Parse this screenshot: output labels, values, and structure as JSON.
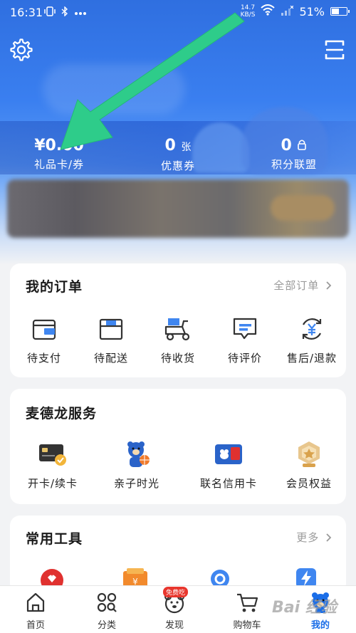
{
  "status_bar": {
    "time": "16:31",
    "speed_value": "14.7",
    "speed_unit": "KB/S",
    "battery": "51%",
    "battery_level": 0.51
  },
  "stats": [
    {
      "value": "¥0.00",
      "unit": "",
      "label": "礼品卡/券"
    },
    {
      "value": "0",
      "unit": "张",
      "label": "优惠券"
    },
    {
      "value": "0",
      "unit": "",
      "label": "积分联盟"
    }
  ],
  "orders": {
    "title": "我的订单",
    "more": "全部订单",
    "items": [
      {
        "label": "待支付",
        "icon": "wallet-icon"
      },
      {
        "label": "待配送",
        "icon": "package-icon"
      },
      {
        "label": "待收货",
        "icon": "delivery-scooter-icon"
      },
      {
        "label": "待评价",
        "icon": "comment-icon"
      },
      {
        "label": "售后/退款",
        "icon": "refund-icon"
      }
    ]
  },
  "services": {
    "title": "麦德龙服务",
    "items": [
      {
        "label": "开卡/续卡",
        "icon": "member-card-icon"
      },
      {
        "label": "亲子时光",
        "icon": "bear-balloon-icon"
      },
      {
        "label": "联名信用卡",
        "icon": "credit-card-icon"
      },
      {
        "label": "会员权益",
        "icon": "medal-icon"
      }
    ]
  },
  "tools": {
    "title": "常用工具",
    "more": "更多"
  },
  "tabbar": {
    "items": [
      {
        "label": "首页",
        "icon": "home-icon"
      },
      {
        "label": "分类",
        "icon": "category-icon"
      },
      {
        "label": "发现",
        "icon": "discover-bear-icon"
      },
      {
        "label": "购物车",
        "icon": "cart-icon"
      },
      {
        "label": "我的",
        "icon": "profile-bear-icon"
      }
    ],
    "discover_badge": "免费吃",
    "active": "我的"
  },
  "watermark": "Bai  经验",
  "colors": {
    "primary": "#1b6ee8",
    "arrow": "#2ecc8a",
    "badge": "#e8362d"
  }
}
